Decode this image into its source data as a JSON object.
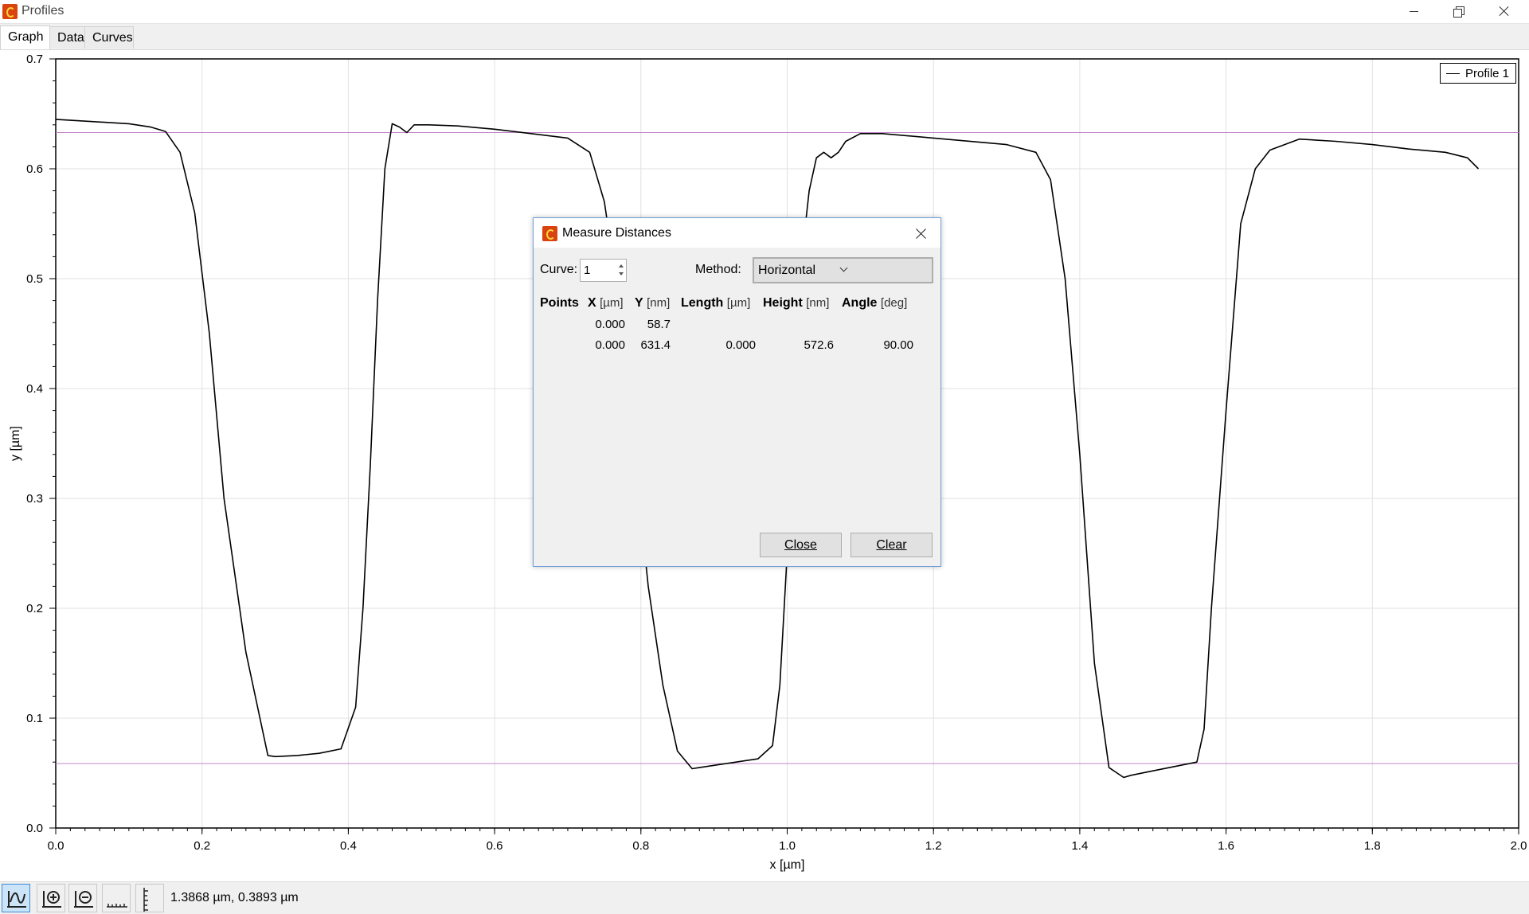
{
  "window": {
    "title": "Profiles"
  },
  "tabs": [
    "Graph",
    "Data",
    "Curves"
  ],
  "legend": {
    "label": "Profile 1"
  },
  "chart_data": {
    "type": "line",
    "xlabel": "x [µm]",
    "ylabel": "y [µm]",
    "xlim": [
      0.0,
      2.0
    ],
    "ylim": [
      0.0,
      0.7
    ],
    "xticks": [
      "0.0",
      "0.2",
      "0.4",
      "0.6",
      "0.8",
      "1.0",
      "1.2",
      "1.4",
      "1.6",
      "1.8",
      "2.0"
    ],
    "yticks": [
      "0.0",
      "0.1",
      "0.2",
      "0.3",
      "0.4",
      "0.5",
      "0.6",
      "0.7"
    ],
    "grid": true,
    "legend_position": "top-right",
    "series": [
      {
        "name": "Profile 1",
        "color": "#000000",
        "x": [
          0.0,
          0.05,
          0.1,
          0.13,
          0.15,
          0.17,
          0.19,
          0.21,
          0.23,
          0.26,
          0.29,
          0.3,
          0.33,
          0.36,
          0.39,
          0.41,
          0.42,
          0.43,
          0.44,
          0.45,
          0.46,
          0.47,
          0.48,
          0.49,
          0.5,
          0.51,
          0.55,
          0.6,
          0.65,
          0.7,
          0.73,
          0.75,
          0.77,
          0.79,
          0.81,
          0.83,
          0.85,
          0.87,
          0.88,
          0.9,
          0.93,
          0.96,
          0.98,
          0.99,
          1.0,
          1.01,
          1.02,
          1.03,
          1.04,
          1.05,
          1.06,
          1.07,
          1.08,
          1.1,
          1.13,
          1.2,
          1.3,
          1.34,
          1.36,
          1.38,
          1.4,
          1.42,
          1.44,
          1.46,
          1.47,
          1.5,
          1.53,
          1.56,
          1.57,
          1.58,
          1.6,
          1.62,
          1.64,
          1.66,
          1.7,
          1.75,
          1.8,
          1.85,
          1.9,
          1.93,
          1.945
        ],
        "y": [
          0.645,
          0.643,
          0.641,
          0.638,
          0.634,
          0.615,
          0.56,
          0.45,
          0.3,
          0.16,
          0.066,
          0.065,
          0.066,
          0.068,
          0.072,
          0.11,
          0.2,
          0.33,
          0.48,
          0.6,
          0.641,
          0.638,
          0.633,
          0.64,
          0.64,
          0.64,
          0.639,
          0.636,
          0.632,
          0.628,
          0.615,
          0.57,
          0.48,
          0.35,
          0.22,
          0.13,
          0.07,
          0.054,
          0.055,
          0.057,
          0.06,
          0.063,
          0.075,
          0.13,
          0.25,
          0.4,
          0.52,
          0.58,
          0.61,
          0.615,
          0.61,
          0.615,
          0.625,
          0.632,
          0.632,
          0.628,
          0.622,
          0.615,
          0.59,
          0.5,
          0.34,
          0.15,
          0.055,
          0.046,
          0.048,
          0.052,
          0.056,
          0.06,
          0.09,
          0.2,
          0.38,
          0.55,
          0.6,
          0.617,
          0.627,
          0.625,
          0.622,
          0.618,
          0.615,
          0.61,
          0.6
        ]
      }
    ],
    "reference_lines": [
      {
        "axis": "y",
        "value": 0.633,
        "color": "#c080c8"
      },
      {
        "axis": "y",
        "value": 0.0587,
        "color": "#c080c8"
      }
    ]
  },
  "dialog": {
    "title": "Measure Distances",
    "curve_label": "Curve:",
    "curve_value": "1",
    "method_label": "Method:",
    "method_value": "Horizontal",
    "columns": [
      {
        "name": "Points",
        "unit": ""
      },
      {
        "name": "X",
        "unit": "[µm]"
      },
      {
        "name": "Y",
        "unit": "[nm]"
      },
      {
        "name": "Length",
        "unit": "[µm]"
      },
      {
        "name": "Height",
        "unit": "[nm]"
      },
      {
        "name": "Angle",
        "unit": "[deg]"
      }
    ],
    "rows": [
      {
        "x": "0.000",
        "y": "58.7",
        "length": "",
        "height": "",
        "angle": ""
      },
      {
        "x": "0.000",
        "y": "631.4",
        "length": "0.000",
        "height": "572.6",
        "angle": "90.00"
      }
    ],
    "close_button": "Close",
    "clear_button": "Clear"
  },
  "statusbar": {
    "tools": [
      "profile-select-icon",
      "zoom-in-icon",
      "zoom-out-icon",
      "measure-horizontal-icon",
      "measure-vertical-icon"
    ],
    "coordinates": "1.3868 µm, 0.3893 µm"
  }
}
